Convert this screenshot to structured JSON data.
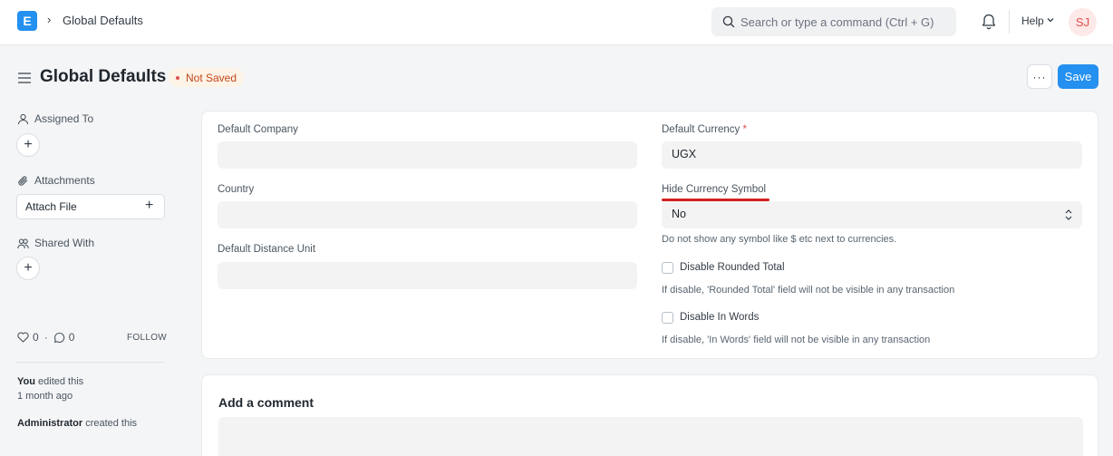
{
  "navbar": {
    "logo_letter": "E",
    "breadcrumb_sep": "›",
    "breadcrumb": "Global Defaults",
    "search_placeholder": "Search or type a command (Ctrl + G)",
    "help_label": "Help",
    "avatar_initials": "SJ"
  },
  "header": {
    "title": "Global Defaults",
    "status": "Not Saved",
    "more_label": "···",
    "save_label": "Save"
  },
  "sidebar": {
    "assigned_to": "Assigned To",
    "attachments": "Attachments",
    "attach_file": "Attach File",
    "shared_with": "Shared With",
    "likes": "0",
    "stats_sep": "·",
    "comments": "0",
    "follow": "FOLLOW",
    "activity": [
      {
        "actor": "You",
        "action": "edited this",
        "time": "1 month ago"
      },
      {
        "actor": "Administrator",
        "action": "created this"
      }
    ]
  },
  "form": {
    "default_company": {
      "label": "Default Company",
      "value": ""
    },
    "country": {
      "label": "Country",
      "value": ""
    },
    "default_distance_unit": {
      "label": "Default Distance Unit",
      "value": ""
    },
    "default_currency": {
      "label": "Default Currency",
      "required_mark": "*",
      "value": "UGX"
    },
    "hide_currency_symbol": {
      "label": "Hide Currency Symbol",
      "value": "No",
      "help": "Do not show any symbol like $ etc next to currencies."
    },
    "disable_rounded_total": {
      "label": "Disable Rounded Total",
      "checked": false,
      "help": "If disable, 'Rounded Total' field will not be visible in any transaction"
    },
    "disable_in_words": {
      "label": "Disable In Words",
      "checked": false,
      "help": "If disable, 'In Words' field will not be visible in any transaction"
    }
  },
  "comments": {
    "title": "Add a comment"
  },
  "colors": {
    "primary": "#2490ef",
    "status_text": "#c2471b",
    "highlight": "#d42020"
  }
}
